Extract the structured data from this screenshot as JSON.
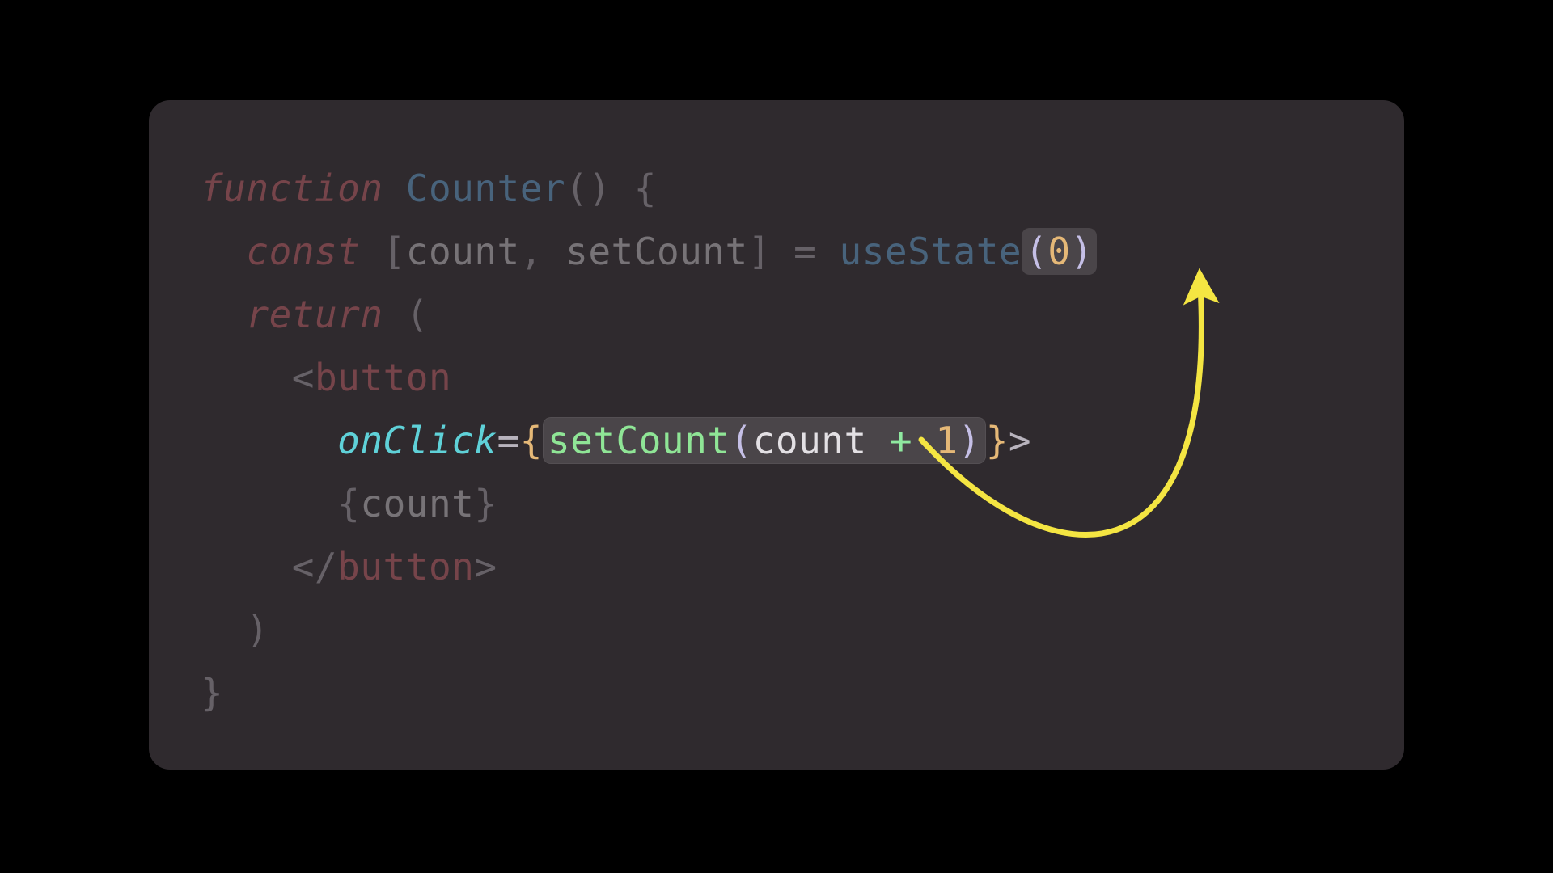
{
  "code": {
    "l1": {
      "kw_function": "function",
      "name": "Counter",
      "parens": "()",
      "brace": "{"
    },
    "l2": {
      "kw_const": "const",
      "lbr": "[",
      "id_count": "count",
      "comma": ",",
      "id_setCount": "setCount",
      "rbr": "]",
      "eq": "=",
      "fn_useState": "useState",
      "lpar": "(",
      "zero": "0",
      "rpar": ")"
    },
    "l3": {
      "kw_return": "return",
      "lpar": "("
    },
    "l4": {
      "lt": "<",
      "tag": "button"
    },
    "l5": {
      "attr": "onClick",
      "eq": "=",
      "lbrace": "{",
      "call": "setCount",
      "lpar": "(",
      "id_count": "count",
      "plus": "+",
      "one": "1",
      "rpar": ")",
      "rbrace": "}",
      "gt": ">"
    },
    "l6": {
      "lbrace": "{",
      "id_count": "count",
      "rbrace": "}"
    },
    "l7": {
      "close_open": "</",
      "tag": "button",
      "gt": ">"
    },
    "l8": {
      "rpar": ")"
    },
    "l9": {
      "rbrace": "}"
    }
  },
  "annotation": {
    "arrow_color": "#f4e542"
  }
}
